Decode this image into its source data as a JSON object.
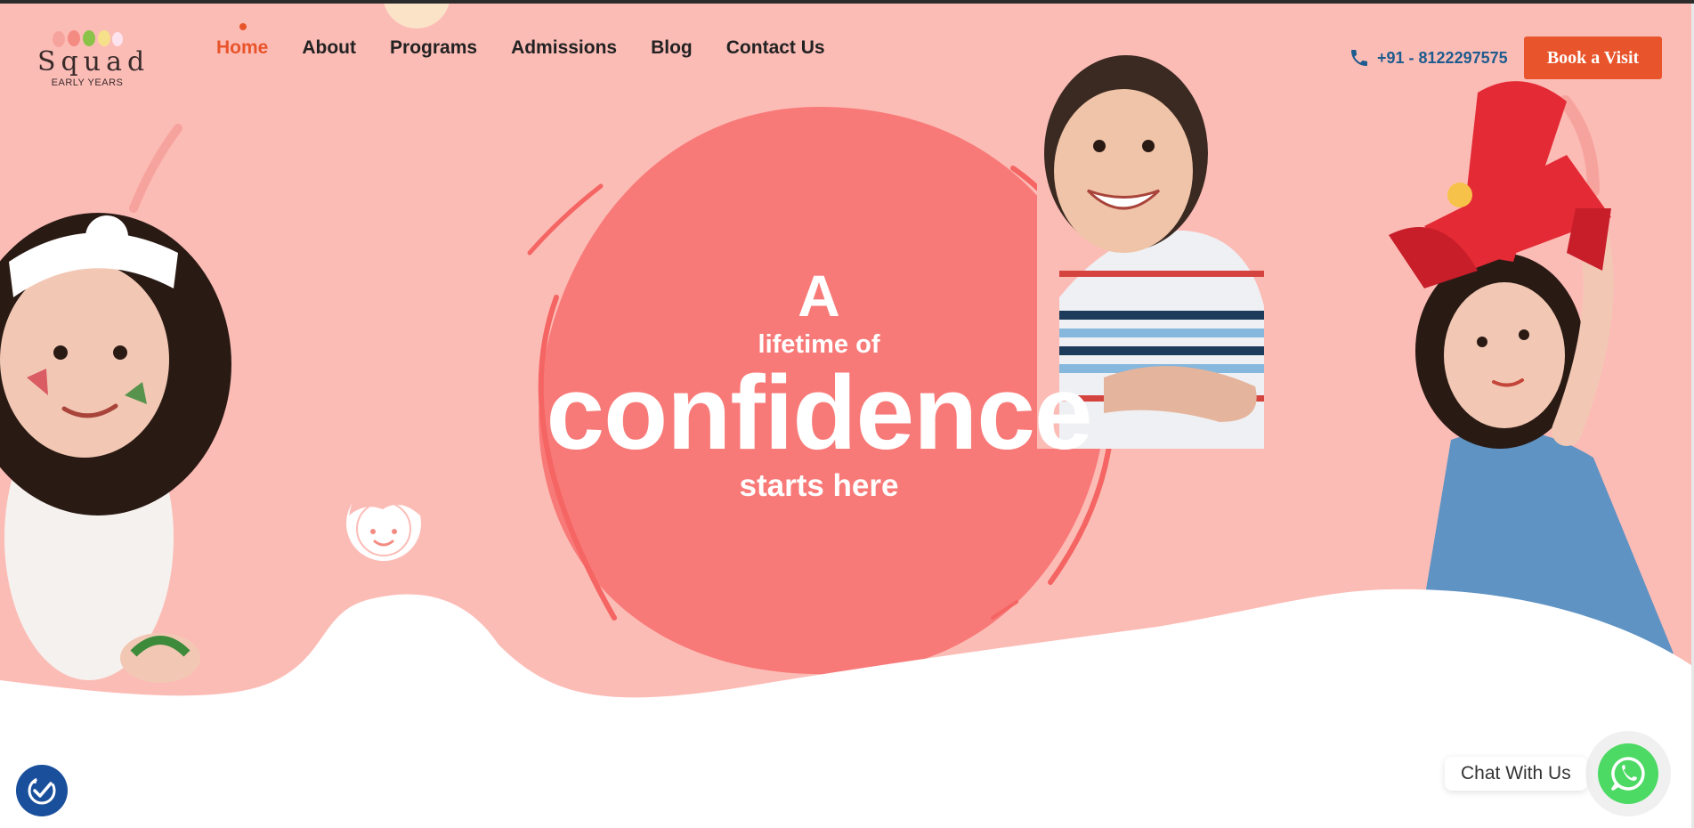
{
  "brand": {
    "logo_word": "Squad",
    "logo_subtitle": "EARLY YEARS",
    "colors": {
      "accent": "#e8542b",
      "hero_bg": "#fcbcb6",
      "blob": "#f87a78",
      "phone": "#1d5c8e",
      "whatsapp": "#4cd964"
    }
  },
  "nav": {
    "items": [
      {
        "label": "Home",
        "active": true
      },
      {
        "label": "About",
        "active": false
      },
      {
        "label": "Programs",
        "active": false
      },
      {
        "label": "Admissions",
        "active": false
      },
      {
        "label": "Blog",
        "active": false
      },
      {
        "label": "Contact Us",
        "active": false
      }
    ]
  },
  "header": {
    "phone_icon": "phone-icon",
    "phone_number": "+91 - 8122297575",
    "cta_label": "Book a Visit"
  },
  "hero": {
    "line1": "A",
    "line2": "lifetime of",
    "line3": "confidence",
    "line4": "starts here"
  },
  "chat": {
    "label": "Chat With Us",
    "icon": "whatsapp-icon"
  },
  "accessibility": {
    "icon": "accessibility-icon"
  }
}
